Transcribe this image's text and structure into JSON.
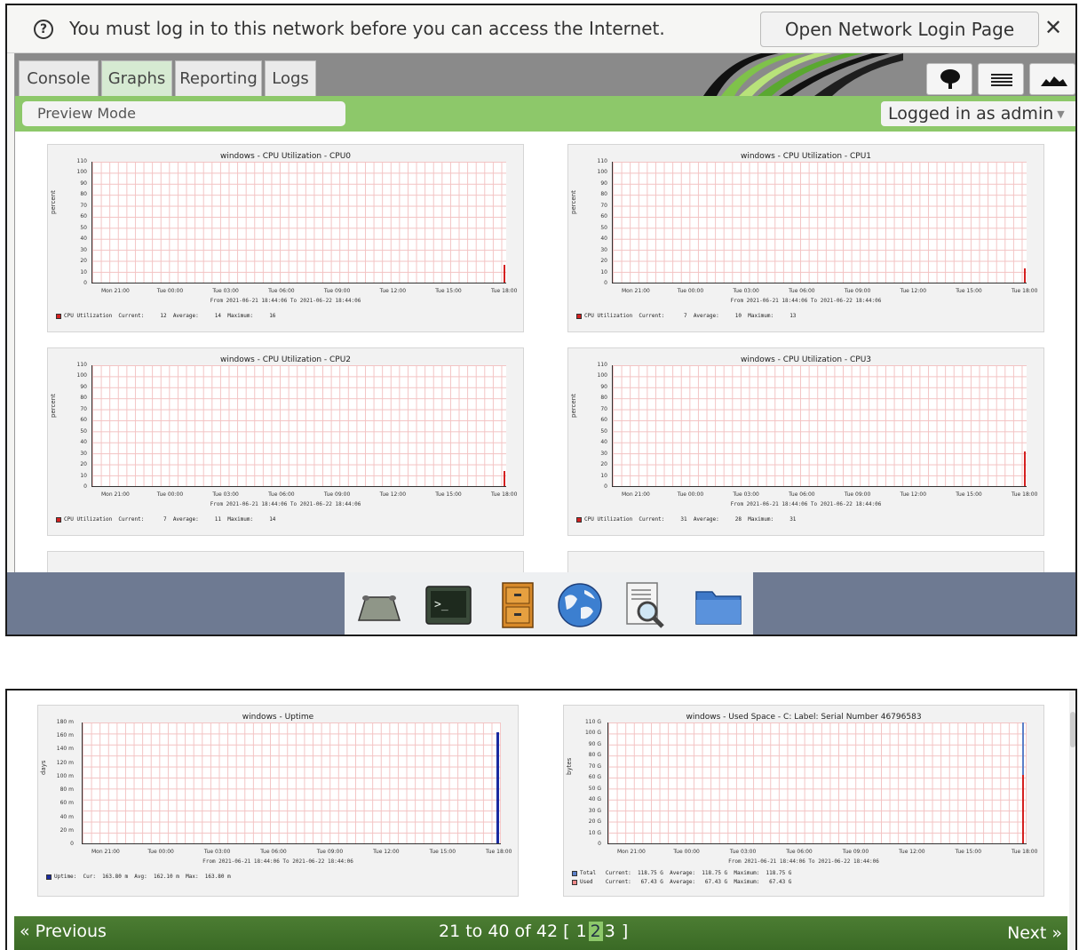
{
  "notification": {
    "message": "You must log in to this network before you can access the Internet.",
    "login_button": "Open Network Login Page",
    "close": "✕"
  },
  "tabs": [
    {
      "label": "Console"
    },
    {
      "label": "Graphs"
    },
    {
      "label": "Reporting"
    },
    {
      "label": "Logs"
    }
  ],
  "toolbar": {
    "preview_mode": "Preview Mode",
    "logged_in": "Logged in as admin"
  },
  "x_ticks": [
    "Mon 21:00",
    "Tue 00:00",
    "Tue 03:00",
    "Tue 06:00",
    "Tue 09:00",
    "Tue 12:00",
    "Tue 15:00",
    "Tue 18:00"
  ],
  "from_to": "From 2021-06-21 18:44:06 To 2021-06-22 18:44:06",
  "graphs": [
    {
      "title": "windows - CPU Utilization - CPU0",
      "ylabel": "percent",
      "legend": "CPU Utilization  Current:     12  Average:     14  Maximum:     16",
      "spike": 16
    },
    {
      "title": "windows - CPU Utilization - CPU1",
      "ylabel": "percent",
      "legend": "CPU Utilization  Current:      7  Average:     10  Maximum:     13",
      "spike": 13
    },
    {
      "title": "windows - CPU Utilization - CPU2",
      "ylabel": "percent",
      "legend": "CPU Utilization  Current:      7  Average:     11  Maximum:     14",
      "spike": 14
    },
    {
      "title": "windows - CPU Utilization - CPU3",
      "ylabel": "percent",
      "legend": "CPU Utilization  Current:     31  Average:     28  Maximum:     31",
      "spike": 31
    }
  ],
  "y_ticks_cpu": [
    "110",
    "100",
    "90",
    "80",
    "70",
    "60",
    "50",
    "40",
    "30",
    "20",
    "10",
    "0"
  ],
  "uptime_graph": {
    "title": "windows - Uptime",
    "ylabel": "days",
    "y_ticks": [
      "180 m",
      "160 m",
      "140 m",
      "120 m",
      "100 m",
      "80 m",
      "60 m",
      "40 m",
      "20 m",
      "0"
    ],
    "legend": "Uptime:  Cur:  163.80 m  Avg:  162.10 m  Max:  163.80 m",
    "value": 163.8
  },
  "space_graph": {
    "title": "windows - Used Space - C: Label:  Serial Number 46796583",
    "ylabel": "bytes",
    "y_ticks": [
      "110 G",
      "100 G",
      "90 G",
      "80 G",
      "70 G",
      "60 G",
      "50 G",
      "40 G",
      "30 G",
      "20 G",
      "10 G",
      "0"
    ],
    "legend_total": "Total   Current:  118.75 G  Average:  118.75 G  Maximum:  118.75 G",
    "legend_used": "Used    Current:   67.43 G  Average:   67.43 G  Maximum:   67.43 G",
    "total": 118.75,
    "used": 67.43
  },
  "pager": {
    "prev": "« Previous",
    "range": "21 to 40 of 42 [",
    "pages": [
      "1",
      "2",
      "3"
    ],
    "close_bracket": "]",
    "next": "Next »"
  },
  "colors": {
    "green_bar": "#8dc86a",
    "pager_green": "#3a6a25",
    "spike_red": "#d42020",
    "uptime_blue": "#1a2aa0"
  },
  "dock_icons": [
    "home-icon",
    "terminal-icon",
    "file-cabinet-icon",
    "globe-icon",
    "document-search-icon",
    "folder-icon"
  ],
  "toolbar_icons": [
    "tree-icon",
    "menu-icon",
    "mountain-chart-icon"
  ]
}
